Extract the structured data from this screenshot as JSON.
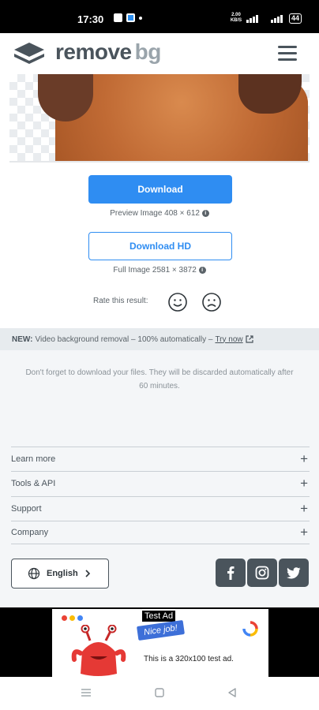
{
  "status_bar": {
    "time": "17:30",
    "network_speed": "2.00 KB/S",
    "battery": "44"
  },
  "header": {
    "logo_text_main": "remove",
    "logo_text_suffix": "bg"
  },
  "result": {
    "download_label": "Download",
    "preview_caption": "Preview Image 408 × 612",
    "download_hd_label": "Download HD",
    "full_caption": "Full Image 2581 × 3872",
    "rate_label": "Rate this result:"
  },
  "new_bar": {
    "prefix": "NEW:",
    "text": "Video background removal – 100% automatically –",
    "link": "Try now"
  },
  "notice": {
    "line1": "Don't forget to download your files. They will be discarded automatically after",
    "line2": "60 minutes."
  },
  "footer": {
    "sections": [
      {
        "label": "Learn more"
      },
      {
        "label": "Tools & API"
      },
      {
        "label": "Support"
      },
      {
        "label": "Company"
      }
    ],
    "plus_glyph": "+",
    "language": "English",
    "social": [
      "facebook-icon",
      "instagram-icon",
      "twitter-icon"
    ]
  },
  "ad": {
    "tag": "Test Ad",
    "badge": "Nice job!",
    "text": "This is a 320x100 test ad."
  },
  "colors": {
    "accent": "#2f8df2",
    "header_text": "#4a545c",
    "new_bar_bg": "#e7ebee"
  }
}
